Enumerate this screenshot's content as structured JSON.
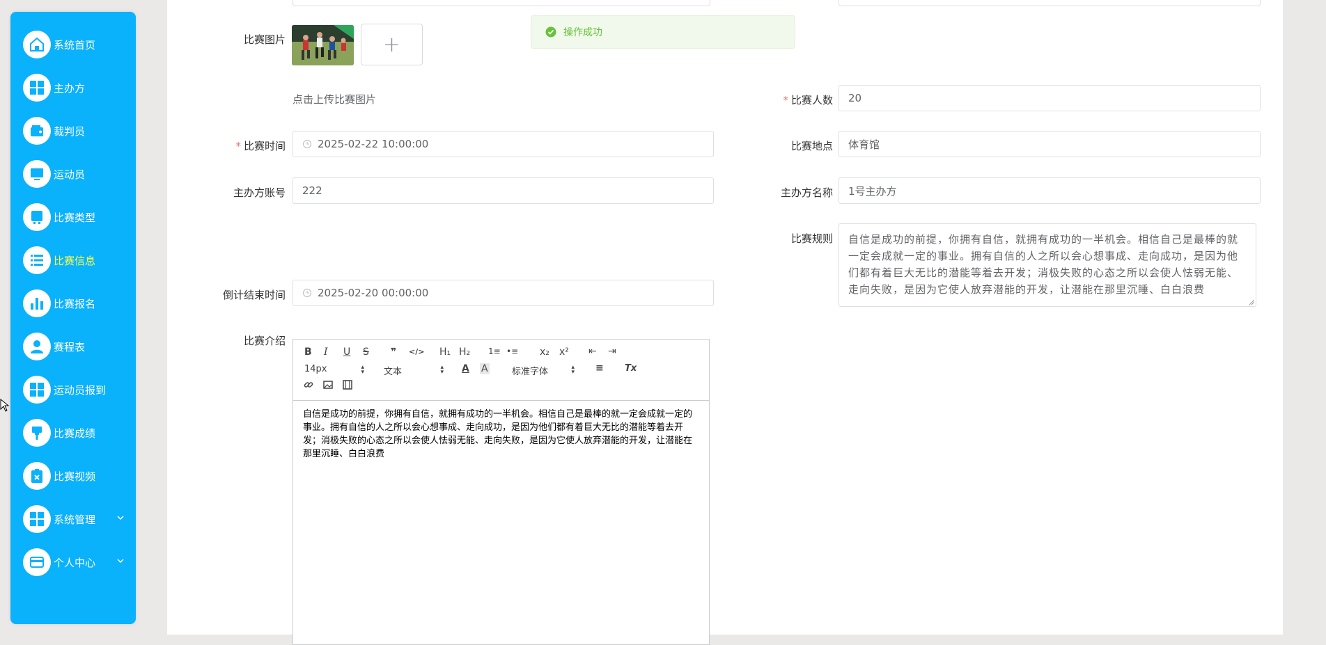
{
  "sidebar": {
    "items": [
      {
        "label": "系统首页",
        "icon": "home-icon"
      },
      {
        "label": "主办方",
        "icon": "grid-icon"
      },
      {
        "label": "裁判员",
        "icon": "wallet-icon"
      },
      {
        "label": "运动员",
        "icon": "monitor-icon"
      },
      {
        "label": "比赛类型",
        "icon": "tablet-icon"
      },
      {
        "label": "比赛信息",
        "icon": "list-icon",
        "active": true
      },
      {
        "label": "比赛报名",
        "icon": "bar-chart-icon"
      },
      {
        "label": "赛程表",
        "icon": "user-icon"
      },
      {
        "label": "运动员报到",
        "icon": "grid-icon"
      },
      {
        "label": "比赛成绩",
        "icon": "brush-icon"
      },
      {
        "label": "比赛视频",
        "icon": "clipboard-icon"
      },
      {
        "label": "系统管理",
        "icon": "grid-icon",
        "expandable": true
      },
      {
        "label": "个人中心",
        "icon": "card-icon",
        "expandable": true
      }
    ]
  },
  "toast": {
    "text": "操作成功",
    "type": "success"
  },
  "form": {
    "image": {
      "label": "比赛图片",
      "hint": "点击上传比赛图片",
      "add_symbol": "+"
    },
    "count": {
      "label": "比赛人数",
      "value": "20",
      "required": true
    },
    "time": {
      "label": "比赛时间",
      "value": "2025-02-22 10:00:00",
      "required": true
    },
    "location": {
      "label": "比赛地点",
      "value": "体育馆"
    },
    "host_account": {
      "label": "主办方账号",
      "value": "222"
    },
    "host_name": {
      "label": "主办方名称",
      "value": "1号主办方"
    },
    "rules": {
      "label": "比赛规则",
      "value": "自信是成功的前提，你拥有自信，就拥有成功的一半机会。相信自己是最棒的就一定会成就一定的事业。拥有自信的人之所以会心想事成、走向成功，是因为他们都有着巨大无比的潜能等着去开发；消极失败的心态之所以会使人怯弱无能、走向失败，是因为它使人放弃潜能的开发，让潜能在那里沉睡、白白浪费"
    },
    "countdown": {
      "label": "倒计结束时间",
      "value": "2025-02-20 00:00:00"
    },
    "intro": {
      "label": "比赛介绍",
      "body": "自信是成功的前提，你拥有自信，就拥有成功的一半机会。相信自己是最棒的就一定会成就一定的事业。拥有自信的人之所以会心想事成、走向成功，是因为他们都有着巨大无比的潜能等着去开发；消极失败的心态之所以会使人怯弱无能、走向失败，是因为它使人放弃潜能的开发，让潜能在那里沉睡、白白浪费"
    }
  },
  "editor": {
    "toolbar": {
      "bold": "B",
      "italic": "I",
      "underline": "U",
      "strike": "S",
      "quote": "❞",
      "code": "</>",
      "h1": "H₁",
      "h2": "H₂",
      "ordered_list": "1≡",
      "bullet_list": "•≡",
      "subscript": "x₂",
      "superscript": "x²",
      "outdent": "⇤",
      "indent": "⇥",
      "size": "14px",
      "format": "文本",
      "font": "标准字体",
      "color": "A",
      "background": "A",
      "align": "≡",
      "clean": "Tx",
      "link": "🔗",
      "image": "▣",
      "video": "▦"
    }
  }
}
